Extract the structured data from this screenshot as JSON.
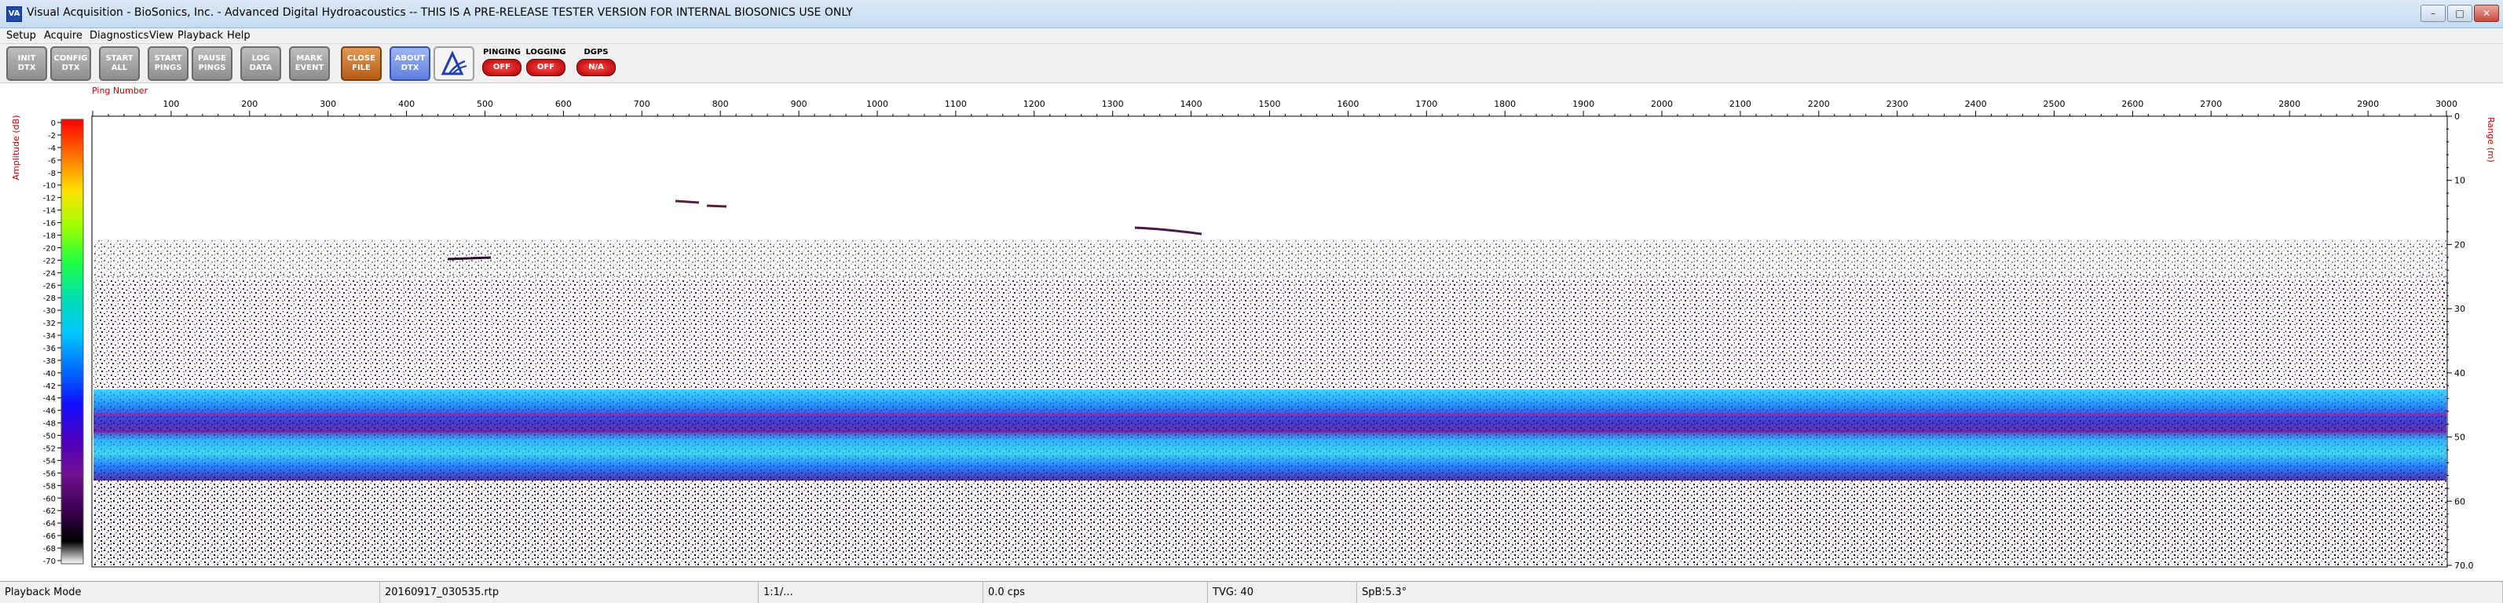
{
  "window": {
    "title": "Visual Acquisition  -  BioSonics, Inc.  -  Advanced Digital Hydroacoustics  -- THIS IS A PRE-RELEASE TESTER VERSION FOR INTERNAL BIOSONICS USE ONLY",
    "icon_text": "VA"
  },
  "menu": [
    "Setup",
    "Acquire",
    "Diagnostics",
    "View",
    "Playback",
    "Help"
  ],
  "toolbar": {
    "buttons": [
      {
        "label": "INIT\nDTX",
        "icon": "init-dtx",
        "style": "gray"
      },
      {
        "label": "CONFIG\nDTX",
        "icon": "config-dtx",
        "style": "gray"
      },
      {
        "label": "START\nALL",
        "icon": "start-all",
        "style": "gray"
      },
      {
        "label": "START\nPINGS",
        "icon": "start-pings",
        "style": "gray"
      },
      {
        "label": "PAUSE\nPINGS",
        "icon": "pause-pings",
        "style": "gray"
      },
      {
        "label": "LOG\nDATA",
        "icon": "log-data",
        "style": "gray"
      },
      {
        "label": "MARK\nEVENT",
        "icon": "mark-event",
        "style": "gray"
      },
      {
        "label": "CLOSE\nFILE",
        "icon": "close-file",
        "style": "orange"
      },
      {
        "label": "ABOUT\nDTX",
        "icon": "about-dtx",
        "style": "blue"
      },
      {
        "label": "",
        "icon": "biosonics-logo-icon",
        "style": "logo"
      }
    ],
    "indicators": [
      {
        "label": "PINGING",
        "state": "OFF"
      },
      {
        "label": "LOGGING",
        "state": "OFF"
      },
      {
        "label": "DGPS",
        "state": "N/A"
      }
    ]
  },
  "echogram": {
    "x_axis_label": "Ping Number",
    "x_ticks": [
      "100",
      "200",
      "300",
      "400",
      "500",
      "600",
      "700",
      "800",
      "900",
      "1000",
      "1100",
      "1200",
      "1300",
      "1400",
      "1500",
      "1600",
      "1700",
      "1800",
      "1900",
      "2000",
      "2100",
      "2200",
      "2300",
      "2400",
      "2500",
      "2600",
      "2700",
      "2800",
      "2900",
      "3000"
    ],
    "x_range": [
      0,
      3000
    ],
    "right_axis_label": "Range (m)",
    "range_ticks": [
      "0",
      "10",
      "20",
      "30",
      "40",
      "50",
      "60",
      "70.0"
    ],
    "range_values": [
      0,
      10,
      20,
      30,
      40,
      50,
      60,
      70
    ],
    "colorbar_label": "Amplitude (dB)",
    "colorbar_ticks": [
      "0",
      "-2",
      "-4",
      "-6",
      "-8",
      "-10",
      "-12",
      "-14",
      "-16",
      "-18",
      "-20",
      "-22",
      "-24",
      "-26",
      "-28",
      "-30",
      "-32",
      "-34",
      "-36",
      "-38",
      "-40",
      "-42",
      "-44",
      "-46",
      "-48",
      "-50",
      "-52",
      "-54",
      "-56",
      "-58",
      "-60",
      "-62",
      "-64",
      "-66",
      "-68",
      "-70"
    ],
    "colorbar_colors": [
      "#ff0000",
      "#ff4000",
      "#ff8000",
      "#ffb000",
      "#ffe000",
      "#ffff00",
      "#c0ff00",
      "#80ff00",
      "#20ff20",
      "#00e060",
      "#00e0b0",
      "#00e0ff",
      "#00a0ff",
      "#0060ff",
      "#0020ff",
      "#2000d0",
      "#5000b0",
      "#7010a0",
      "#6a008a",
      "#4c006a",
      "#2a0044",
      "#000000",
      "#ffffff"
    ]
  },
  "status": {
    "mode": "Playback Mode",
    "file": "20160917_030535.rtp",
    "ratio": "1:1/...",
    "rate": "0.0 cps",
    "tvg": "TVG: 40",
    "sp": "SpB:5.3°"
  }
}
